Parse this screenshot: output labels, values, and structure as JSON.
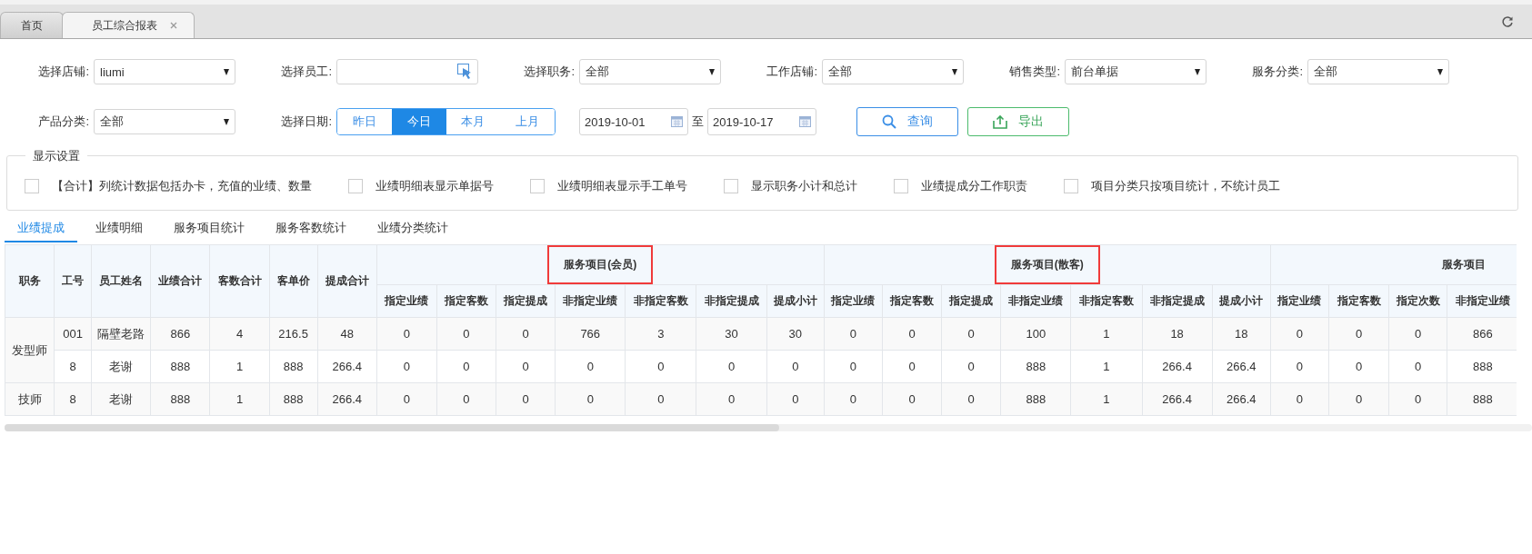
{
  "tabs": [
    {
      "label": "首页",
      "selected": false,
      "closable": false
    },
    {
      "label": "员工综合报表",
      "selected": true,
      "closable": true
    }
  ],
  "filter_rows": [
    [
      {
        "kind": "select",
        "label": "选择店铺:",
        "value": "liumi"
      },
      {
        "kind": "picker",
        "label": "选择员工:"
      },
      {
        "kind": "select",
        "label": "选择职务:",
        "value": "全部"
      },
      {
        "kind": "select",
        "label": "工作店铺:",
        "value": "全部"
      },
      {
        "kind": "select",
        "label": "销售类型:",
        "value": "前台单据"
      },
      {
        "kind": "select",
        "label": "服务分类:",
        "value": "全部"
      }
    ],
    [
      {
        "kind": "select",
        "label": "产品分类:",
        "value": "全部"
      },
      {
        "kind": "segmented",
        "label": "选择日期:",
        "options": [
          {
            "label": "昨日",
            "selected": false
          },
          {
            "label": "今日",
            "selected": true
          },
          {
            "label": "本月",
            "selected": false
          },
          {
            "label": "上月",
            "selected": false
          }
        ]
      },
      {
        "kind": "date_range",
        "from": "2019-10-01",
        "separator": "至",
        "to": "2019-10-17"
      },
      {
        "kind": "search_button",
        "label": "查询"
      },
      {
        "kind": "export_button",
        "label": "导出"
      }
    ]
  ],
  "display_settings": {
    "title": "显示设置",
    "options": [
      {
        "label": "【合计】列统计数据包括办卡，充值的业绩、数量",
        "checked": false
      },
      {
        "label": "业绩明细表显示单据号",
        "checked": false
      },
      {
        "label": "业绩明细表显示手工单号",
        "checked": false
      },
      {
        "label": "显示职务小计和总计",
        "checked": false
      },
      {
        "label": "业绩提成分工作职责",
        "checked": false
      },
      {
        "label": "项目分类只按项目统计，不统计员工",
        "checked": false
      }
    ]
  },
  "report_tabs": [
    {
      "label": "业绩提成",
      "selected": true
    },
    {
      "label": "业绩明细",
      "selected": false
    },
    {
      "label": "服务项目统计",
      "selected": false
    },
    {
      "label": "服务客数统计",
      "selected": false
    },
    {
      "label": "业绩分类统计",
      "selected": false
    }
  ],
  "table": {
    "fixed_columns": [
      "职务",
      "工号",
      "员工姓名",
      "业绩合计",
      "客数合计",
      "客单价",
      "提成合计"
    ],
    "column_groups": [
      {
        "title": "服务项目(会员)",
        "highlighted": true,
        "columns": [
          "指定业绩",
          "指定客数",
          "指定提成",
          "非指定业绩",
          "非指定客数",
          "非指定提成",
          "提成小计"
        ]
      },
      {
        "title": "服务项目(散客)",
        "highlighted": true,
        "columns": [
          "指定业绩",
          "指定客数",
          "指定提成",
          "非指定业绩",
          "非指定客数",
          "非指定提成",
          "提成小计"
        ]
      },
      {
        "title": "服务项目",
        "highlighted": false,
        "columns": [
          "指定业绩",
          "指定客数",
          "指定次数",
          "非指定业绩"
        ]
      }
    ],
    "row_groups": [
      {
        "role": "发型师",
        "rows": [
          {
            "cells": [
              "001",
              "隔壁老路",
              "866",
              "4",
              "216.5",
              "48",
              "0",
              "0",
              "0",
              "766",
              "3",
              "30",
              "30",
              "0",
              "0",
              "0",
              "100",
              "1",
              "18",
              "18",
              "0",
              "0",
              "0",
              "866"
            ]
          },
          {
            "cells": [
              "8",
              "老谢",
              "888",
              "1",
              "888",
              "266.4",
              "0",
              "0",
              "0",
              "0",
              "0",
              "0",
              "0",
              "0",
              "0",
              "0",
              "888",
              "1",
              "266.4",
              "266.4",
              "0",
              "0",
              "0",
              "888"
            ]
          }
        ]
      },
      {
        "role": "技师",
        "rows": [
          {
            "cells": [
              "8",
              "老谢",
              "888",
              "1",
              "888",
              "266.4",
              "0",
              "0",
              "0",
              "0",
              "0",
              "0",
              "0",
              "0",
              "0",
              "0",
              "888",
              "1",
              "266.4",
              "266.4",
              "0",
              "0",
              "0",
              "888"
            ]
          }
        ]
      }
    ]
  }
}
